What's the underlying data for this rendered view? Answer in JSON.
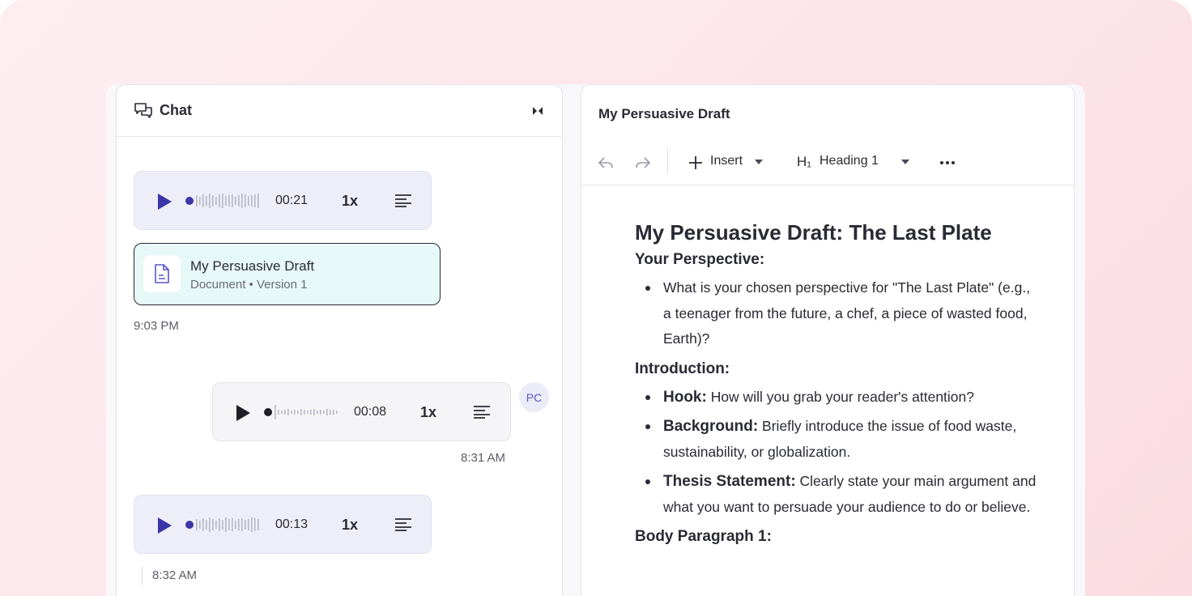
{
  "colors": {
    "accent": "#3b36a8",
    "doc_card_bg": "#e6f8f7",
    "bot_bubble_bg": "#eeeef9"
  },
  "chat": {
    "title": "Chat",
    "title_icon": "chat-bubbles-icon",
    "collapse_icon": "collapse-icon",
    "messages": [
      {
        "type": "audio",
        "sender": "assistant",
        "duration": "00:21",
        "speed": "1x"
      },
      {
        "type": "document",
        "title": "My Persuasive Draft",
        "subtitle": "Document • Version 1",
        "time": "9:03 PM"
      },
      {
        "type": "audio",
        "sender": "user",
        "avatar": "PC",
        "duration": "00:08",
        "speed": "1x",
        "time": "8:31 AM"
      },
      {
        "type": "audio",
        "sender": "assistant",
        "duration": "00:13",
        "speed": "1x",
        "time": "8:32 AM"
      }
    ]
  },
  "document": {
    "header_title": "My Persuasive Draft",
    "toolbar": {
      "insert_label": "Insert",
      "heading_label": "Heading 1",
      "heading_icon": "H₁"
    },
    "content": {
      "title": "My Persuasive Draft: The Last Plate",
      "sections": [
        {
          "heading": "Your Perspective:",
          "items": [
            {
              "bold": "",
              "text": "What is your chosen perspective for \"The Last Plate\" (e.g., a teenager from the future, a chef, a piece of wasted food, Earth)?"
            }
          ]
        },
        {
          "heading": "Introduction:",
          "items": [
            {
              "bold": "Hook:",
              "text": " How will you grab your reader's attention?"
            },
            {
              "bold": "Background:",
              "text": " Briefly introduce the issue of food waste, sustainability, or globalization."
            },
            {
              "bold": "Thesis Statement:",
              "text": " Clearly state your main argument and what you want to persuade your audience to do or believe."
            }
          ]
        },
        {
          "heading": "Body Paragraph 1:",
          "items": []
        }
      ]
    }
  }
}
